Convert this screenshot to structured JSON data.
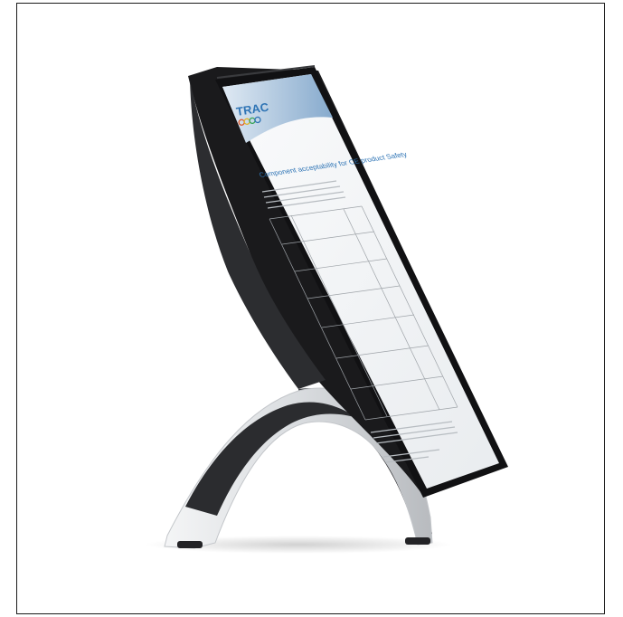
{
  "photo": {
    "subject": "Tablet-style document display stand with black frame on a curved arched base",
    "colors": {
      "frame": "#1c1c1e",
      "base_light": "#e6e8ea",
      "base_dark": "#2a2b2e",
      "page": "#f5f6f7",
      "header_blue": "#8fb3d6",
      "logo_blue": "#2e74b5"
    }
  },
  "document": {
    "logo": "TRAC",
    "title": "Component acceptability for CE product Safety"
  }
}
